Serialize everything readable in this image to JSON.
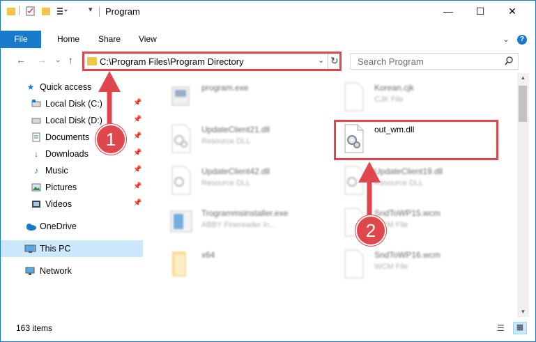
{
  "window": {
    "title": "Program",
    "minimize_glyph": "—",
    "maximize_glyph": "☐",
    "close_glyph": "✕"
  },
  "ribbon": {
    "file": "File",
    "home": "Home",
    "share": "Share",
    "view": "View"
  },
  "address": {
    "path": "C:\\Program Files\\Program Directory"
  },
  "search": {
    "placeholder": "Search Program"
  },
  "sidebar": {
    "items": [
      {
        "label": "Quick access",
        "icon": "star-icon"
      },
      {
        "label": "Local Disk (C:)",
        "icon": "drive-icon",
        "pinned": true
      },
      {
        "label": "Local Disk (D:)",
        "icon": "drive-icon",
        "pinned": true
      },
      {
        "label": "Documents",
        "icon": "documents-icon",
        "pinned": true
      },
      {
        "label": "Downloads",
        "icon": "downloads-icon",
        "pinned": true
      },
      {
        "label": "Music",
        "icon": "music-icon",
        "pinned": true
      },
      {
        "label": "Pictures",
        "icon": "pictures-icon",
        "pinned": true
      },
      {
        "label": "Videos",
        "icon": "videos-icon",
        "pinned": true
      },
      {
        "label": "OneDrive",
        "icon": "onedrive-icon"
      },
      {
        "label": "This PC",
        "icon": "computer-icon",
        "selected": true
      },
      {
        "label": "Network",
        "icon": "network-icon"
      }
    ]
  },
  "files": [
    {
      "name": "program.exe",
      "type": ""
    },
    {
      "name": "Korean.cjk",
      "type": "CJK File"
    },
    {
      "name": "UpdateClient21.dll",
      "type": "Resource DLL"
    },
    {
      "name": "out_wm.dll",
      "type": ""
    },
    {
      "name": "UpdateClient42.dll",
      "type": "Resource DLL"
    },
    {
      "name": "UpdateClient19.dll",
      "type": "Resource DLL"
    },
    {
      "name": "Trogrammsinstaller.exe",
      "type": "ABBY Finereader In..."
    },
    {
      "name": "SndToWP15.wcm",
      "type": "WCM File"
    },
    {
      "name": "x64",
      "type": ""
    },
    {
      "name": "SndToWP16.wcm",
      "type": "WCM File"
    }
  ],
  "status": {
    "item_count": "163 items"
  },
  "annotations": {
    "step1": "1",
    "step2": "2"
  },
  "colors": {
    "accent": "#1979ca",
    "highlight_red": "#e0474c",
    "selection": "#cce8ff"
  }
}
